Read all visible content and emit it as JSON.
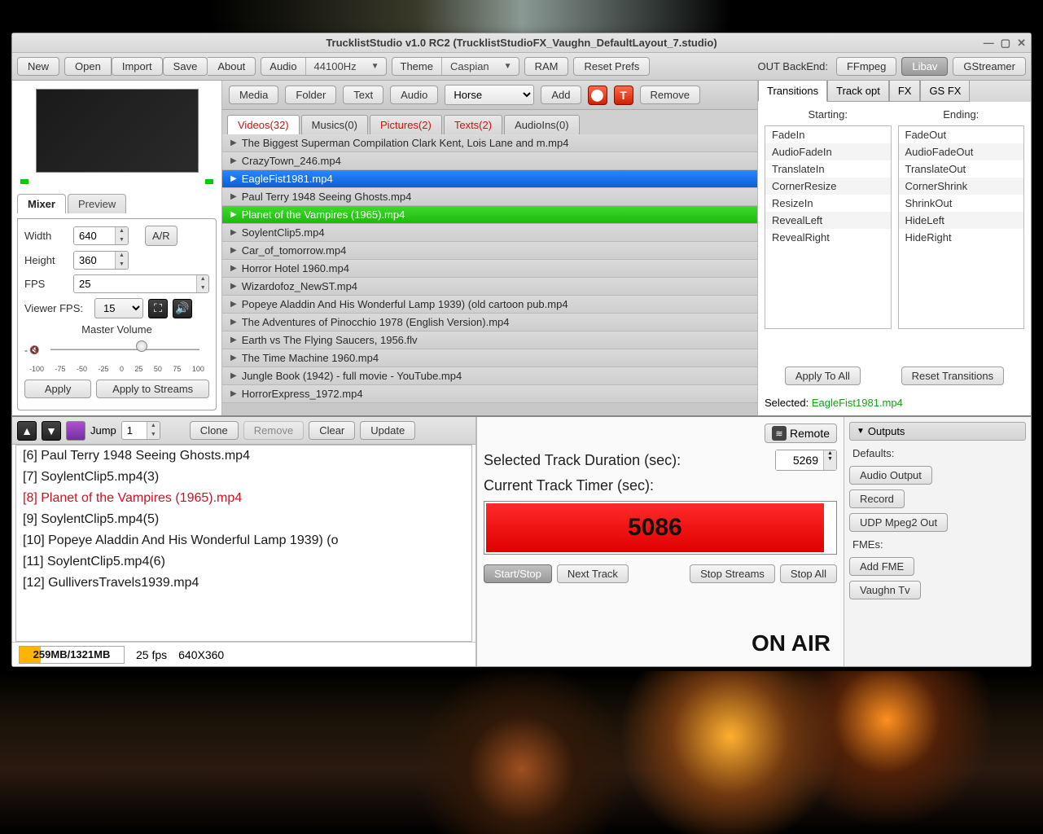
{
  "titlebar": "TrucklistStudio v1.0 RC2 (TrucklistStudioFX_Vaughn_DefaultLayout_7.studio)",
  "toolbar": {
    "new": "New",
    "open": "Open",
    "import": "Import",
    "save": "Save",
    "about": "About",
    "audio_lbl": "Audio",
    "audio_val": "44100Hz",
    "theme_lbl": "Theme",
    "theme_val": "Caspian",
    "ram": "RAM",
    "reset": "Reset Prefs",
    "backend": "OUT BackEnd: ",
    "ffmpeg": "FFmpeg",
    "libav": "Libav",
    "gstreamer": "GStreamer"
  },
  "mixer": {
    "tab_mixer": "Mixer",
    "tab_preview": "Preview",
    "width_lbl": "Width",
    "width_val": "640",
    "height_lbl": "Height",
    "height_val": "360",
    "ar": "A/R",
    "fps_lbl": "FPS",
    "fps_val": "25",
    "vfps_lbl": "Viewer FPS:",
    "vfps_val": "15",
    "volume_lbl": "Master Volume",
    "ticks": [
      "-100",
      "-75",
      "-50",
      "-25",
      "0",
      "25",
      "50",
      "75",
      "100"
    ],
    "apply": "Apply",
    "apply_streams": "Apply to Streams"
  },
  "center": {
    "media": "Media",
    "folder": "Folder",
    "text": "Text",
    "audio": "Audio",
    "combo_val": "Horse",
    "add": "Add",
    "remove": "Remove",
    "tabs": {
      "videos": "Videos(32)",
      "musics": "Musics(0)",
      "pictures": "Pictures(2)",
      "texts": "Texts(2)",
      "audioins": "AudioIns(0)"
    },
    "files": [
      "The Biggest Superman Compilation Clark Kent, Lois Lane and m.mp4",
      "CrazyTown_246.mp4",
      "EagleFist1981.mp4",
      "Paul Terry 1948 Seeing Ghosts.mp4",
      "Planet of the Vampires (1965).mp4",
      "SoylentClip5.mp4",
      "Car_of_tomorrow.mp4",
      "Horror Hotel 1960.mp4",
      "Wizardofoz_NewST.mp4",
      "Popeye Aladdin And His Wonderful Lamp 1939) (old cartoon pub.mp4",
      "The Adventures of Pinocchio 1978 (English Version).mp4",
      "Earth vs The Flying Saucers, 1956.flv",
      "The Time Machine 1960.mp4",
      "Jungle Book (1942) - full movie - YouTube.mp4",
      "HorrorExpress_1972.mp4"
    ],
    "selected_index": 2,
    "green_index": 4
  },
  "right": {
    "tabs": {
      "transitions": "Transitions",
      "trackopt": "Track opt",
      "fx": "FX",
      "gsfx": "GS FX"
    },
    "starting_lbl": "Starting:",
    "ending_lbl": "Ending:",
    "starting": [
      "FadeIn",
      "AudioFadeIn",
      "TranslateIn",
      "CornerResize",
      "ResizeIn",
      "RevealLeft",
      "RevealRight"
    ],
    "ending": [
      "FadeOut",
      "AudioFadeOut",
      "TranslateOut",
      "CornerShrink",
      "ShrinkOut",
      "HideLeft",
      "HideRight"
    ],
    "apply": "Apply To All",
    "reset": "Reset Transitions",
    "selected_lbl": "Selected:  ",
    "selected_val": "EagleFist1981.mp4"
  },
  "bottom": {
    "jump_lbl": "Jump",
    "jump_val": "1",
    "clone": "Clone",
    "remove": "Remove",
    "clear": "Clear",
    "update": "Update",
    "remote": "Remote",
    "playlist": [
      "[6] Paul Terry 1948 Seeing Ghosts.mp4",
      "[7] SoylentClip5.mp4(3)",
      "[8] Planet of the Vampires (1965).mp4",
      "[9] SoylentClip5.mp4(5)",
      "[10] Popeye Aladdin And His Wonderful Lamp 1939) (o",
      "[11] SoylentClip5.mp4(6)",
      "[12] GulliversTravels1939.mp4"
    ],
    "playlist_red_index": 2,
    "dur_lbl": "Selected Track Duration (sec):",
    "dur_val": "5269",
    "timer_lbl": "Current Track Timer (sec):",
    "timer_val": "5086",
    "start": "Start/Stop",
    "next": "Next Track",
    "stopstreams": "Stop Streams",
    "stopall": "Stop All",
    "mem": "259MB/1321MB",
    "fps": "25 fps",
    "res": "640X360",
    "onair": "ON AIR"
  },
  "outputs": {
    "header": "Outputs",
    "defaults": "Defaults:",
    "audio": "Audio Output",
    "record": "Record",
    "udp": "UDP Mpeg2 Out",
    "fmes": "FMEs:",
    "addfme": "Add FME",
    "vaughn": "Vaughn Tv"
  }
}
